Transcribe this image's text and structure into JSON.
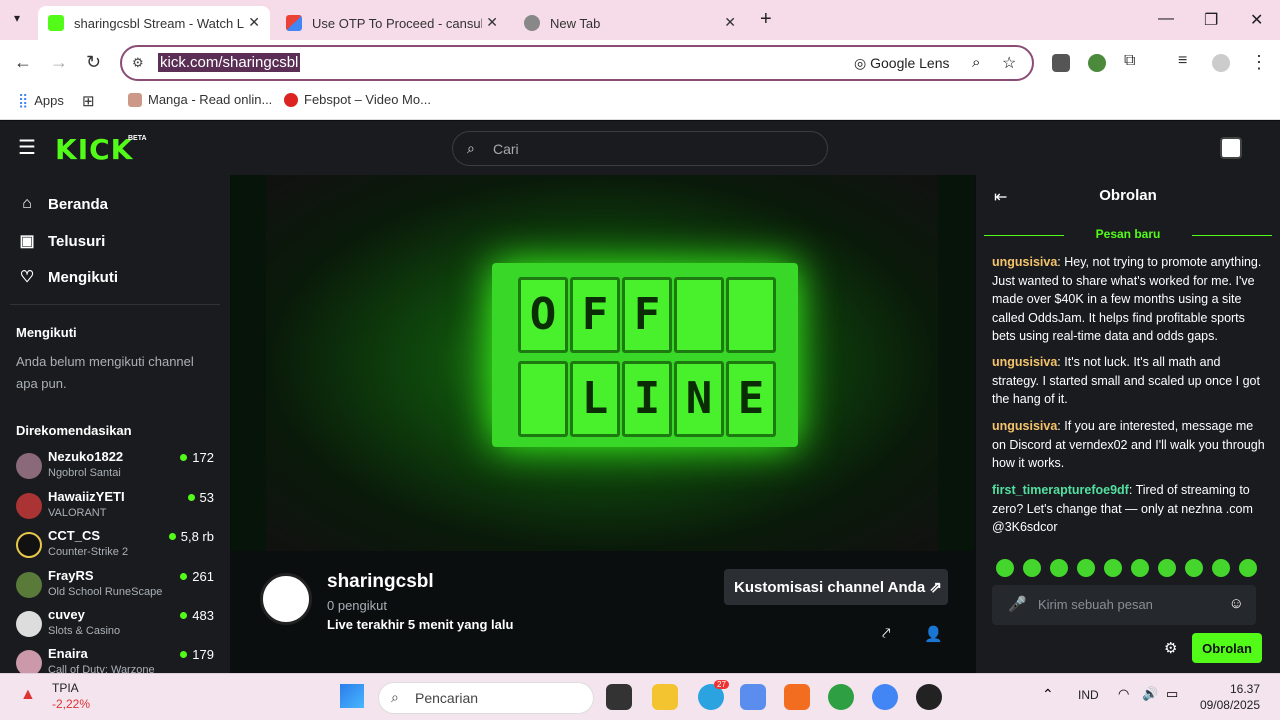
{
  "browser": {
    "tabs": [
      {
        "title": "sharingcsbl Stream - Watch Live",
        "active": true
      },
      {
        "title": "Use OTP To Proceed - cansubbe",
        "active": false
      },
      {
        "title": "New Tab",
        "active": false
      }
    ],
    "url": "kick.com/sharingcsbl",
    "lens_label": "Google Lens",
    "bookmarks": [
      "Apps",
      "Manga - Read onlin...",
      "Febspot – Video Mo..."
    ]
  },
  "kick": {
    "logo": "KICK",
    "beta": "BETA",
    "search_placeholder": "Cari",
    "nav": [
      "Beranda",
      "Telusuri",
      "Mengikuti"
    ],
    "following_header": "Mengikuti",
    "following_empty": "Anda belum mengikuti channel apa pun.",
    "recommended_header": "Direkomendasikan",
    "recommended": [
      {
        "name": "Nezuko1822",
        "category": "Ngobrol Santai",
        "viewers": "172"
      },
      {
        "name": "HawaiizYETI",
        "category": "VALORANT",
        "viewers": "53"
      },
      {
        "name": "CCT_CS",
        "category": "Counter-Strike 2",
        "viewers": "5,8 rb"
      },
      {
        "name": "FrayRS",
        "category": "Old School RuneScape",
        "viewers": "261"
      },
      {
        "name": "cuvey",
        "category": "Slots & Casino",
        "viewers": "483"
      },
      {
        "name": "Enaira",
        "category": "Call of Duty: Warzone",
        "viewers": "179"
      }
    ],
    "offline_letters": [
      "O",
      "F",
      "F",
      "",
      "",
      "",
      "L",
      "I",
      "N",
      "E"
    ],
    "channel": {
      "name": "sharingcsbl",
      "followers": "0 pengikut",
      "last_live": "Live terakhir 5 menit yang lalu",
      "customize_button": "Kustomisasi channel Anda"
    },
    "chat": {
      "title": "Obrolan",
      "new_messages": "Pesan baru",
      "messages": [
        {
          "user": "ungusisiva",
          "color": "#f5c36b",
          "text": " Hey, not trying to promote anything. Just wanted to share what's worked for me. I've made over $40K in a few months using a site called OddsJam. It helps find profitable sports bets using real-time data and odds gaps."
        },
        {
          "user": "ungusisiva",
          "color": "#f5c36b",
          "text": " It's not luck. It's all math and strategy. I started small and scaled up once I got the hang of it."
        },
        {
          "user": "ungusisiva",
          "color": "#f5c36b",
          "text": " If you are interested, message me on Discord at verndex02 and I'll walk you through how it works."
        },
        {
          "user": "first_timerapturefoe9df",
          "color": "#53e0a0",
          "text": " Tired of streaming to zero? Let's change that — only at nezhna .com @3K6sdcor"
        }
      ],
      "input_placeholder": "Kirim sebuah pesan",
      "send_button": "Obrolan"
    }
  },
  "taskbar": {
    "stock_name": "TPIA",
    "stock_change": "-2,22%",
    "search_label": "Pencarian",
    "lang": "IND",
    "time": "16.37",
    "date": "09/08/2025",
    "telegram_badge": "27"
  },
  "colors": {
    "kick_green": "#53fc18",
    "chrome_pink": "#f6dbe8"
  }
}
